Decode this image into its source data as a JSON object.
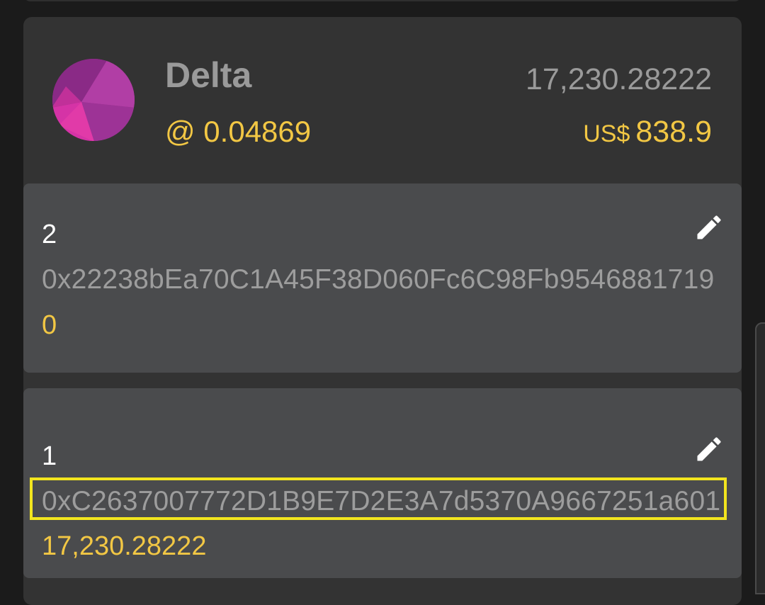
{
  "token": {
    "name": "Delta",
    "price": "@ 0.04869",
    "balance": "17,230.28222",
    "fiat_currency": "US$",
    "fiat_value": "838.9",
    "icon": "delta-token-logo-icon",
    "accent_color": "#f2c744"
  },
  "addresses": [
    {
      "label": "2",
      "address": "0x22238bEa70C1A45F38D060Fc6C98Fb9546881719",
      "balance": "0",
      "edit_icon": "pencil-icon",
      "highlighted": false
    },
    {
      "label": "1",
      "address": "0xC2637007772D1B9E7D2E3A7d5370A9667251a601",
      "balance": "17,230.28222",
      "edit_icon": "pencil-icon",
      "highlighted": true,
      "highlight_color": "#f2e51e"
    }
  ]
}
